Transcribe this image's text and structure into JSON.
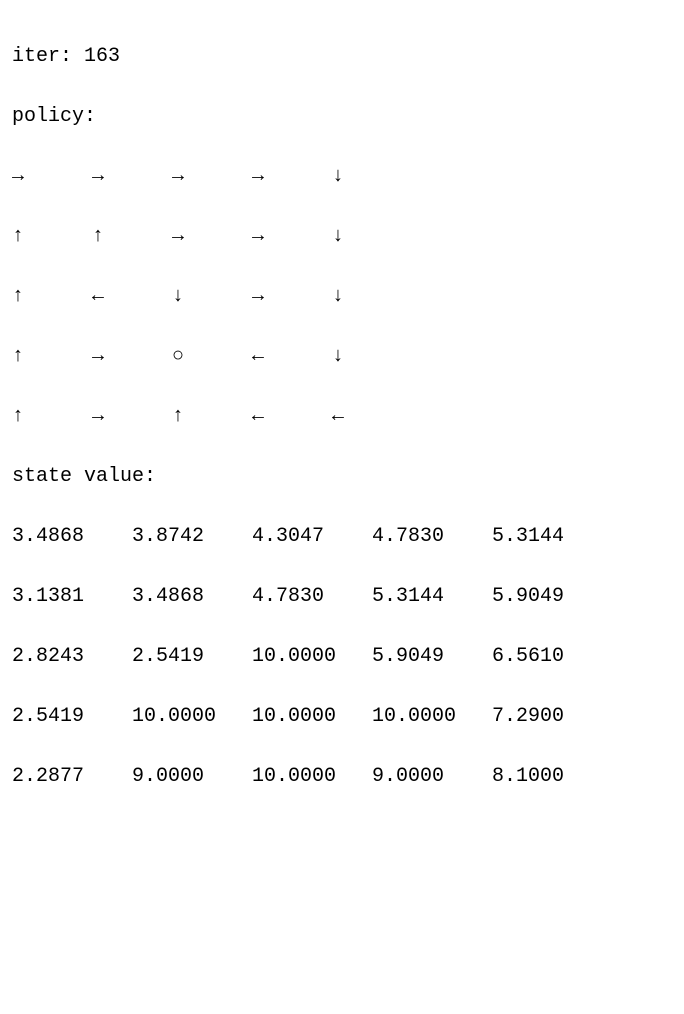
{
  "iter": {
    "label": "iter:",
    "value": "163"
  },
  "policy": {
    "label": "policy:",
    "grid": [
      [
        "→",
        "→",
        "→",
        "→",
        "↓"
      ],
      [
        "↑",
        "↑",
        "→",
        "→",
        "↓"
      ],
      [
        "↑",
        "←",
        "↓",
        "→",
        "↓"
      ],
      [
        "↑",
        "→",
        "○",
        "←",
        "↓"
      ],
      [
        "↑",
        "→",
        "↑",
        "←",
        "←"
      ]
    ]
  },
  "state_value": {
    "label": "state value:",
    "grid": [
      [
        "3.4868",
        "3.8742",
        "4.3047",
        "4.7830",
        "5.3144"
      ],
      [
        "3.1381",
        "3.4868",
        "4.7830",
        "5.3144",
        "5.9049"
      ],
      [
        "2.8243",
        "2.5419",
        "10.0000",
        "5.9049",
        "6.5610"
      ],
      [
        "2.5419",
        "10.0000",
        "10.0000",
        "10.0000",
        "7.2900"
      ],
      [
        "2.2877",
        "9.0000",
        "10.0000",
        "9.0000",
        "8.1000"
      ]
    ]
  }
}
